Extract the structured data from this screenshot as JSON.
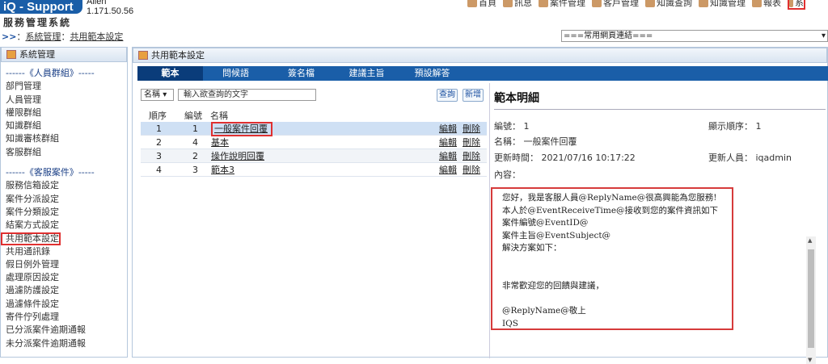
{
  "header": {
    "logo": "iQ - Support",
    "user": "Allen",
    "version": "1.171.50.56",
    "system_title": "服務管理系統",
    "nav": [
      {
        "label": "首頁",
        "icon": "home-icon"
      },
      {
        "label": "訊息",
        "icon": "message-icon"
      },
      {
        "label": "案件管理",
        "icon": "case-icon"
      },
      {
        "label": "客戶管理",
        "icon": "customer-icon"
      },
      {
        "label": "知識查詢",
        "icon": "knowledge-icon"
      },
      {
        "label": "知識管理",
        "icon": "knowledge-manage-icon"
      },
      {
        "label": "報表",
        "icon": "report-icon"
      },
      {
        "label": "系",
        "icon": "settings-icon"
      }
    ]
  },
  "breadcrumb": {
    "arrow": ">>",
    "sep": "：",
    "item1": "系統管理",
    "divider": "：",
    "item2": "共用範本設定"
  },
  "quick_links": {
    "value": "===常用網頁連結===",
    "arrow": "▾"
  },
  "sidebar": {
    "title": "系統管理",
    "group1": "------《人員群組》-----",
    "group1_items": [
      "部門管理",
      "人員管理",
      "權限群組",
      "知識群組",
      "知識審核群組",
      "客服群組"
    ],
    "group2": "------《客服案件》-----",
    "group2_items": [
      "服務信箱設定",
      "案件分派設定",
      "案件分類設定",
      "結案方式設定",
      "共用範本設定",
      "共用通訊錄",
      "假日例外管理",
      "處理原因設定",
      "過濾防護設定",
      "過濾條件設定",
      "寄件佇列處理",
      "已分派案件逾期通報",
      "未分派案件逾期通報"
    ]
  },
  "panel": {
    "title": "共用範本設定"
  },
  "tabs": [
    "範本",
    "問候語",
    "簽名檔",
    "建議主旨",
    "預設解答"
  ],
  "search": {
    "field": "名稱",
    "placeholder": "輸入欲查詢的文字",
    "query_label": "查詢",
    "add_label": "新增"
  },
  "table": {
    "headers": [
      "順序",
      "編號",
      "名稱"
    ],
    "rows": [
      {
        "order": "1",
        "id": "1",
        "name": "一般案件回覆",
        "edit": "編輯",
        "delete": "刪除"
      },
      {
        "order": "2",
        "id": "4",
        "name": "基本",
        "edit": "編輯",
        "delete": "刪除"
      },
      {
        "order": "3",
        "id": "2",
        "name": "操作說明回覆",
        "edit": "編輯",
        "delete": "刪除"
      },
      {
        "order": "4",
        "id": "3",
        "name": "範本3",
        "edit": "編輯",
        "delete": "刪除"
      }
    ]
  },
  "detail": {
    "title": "範本明細",
    "id_line": "編號： 1",
    "order_line": "顯示順序： 1",
    "name_line": "名稱： 一般案件回覆",
    "updated_line": "更新時間： 2021/07/16 10:17:22",
    "updater_line": "更新人員： iqadmin",
    "content_label": "內容：",
    "content": "您好，我是客服人員@ReplyName@很高興能為您服務!\n本人於@EventReceiveTime@接收到您的案件資訊如下\n案件編號@EventID@\n案件主旨@EventSubject@\n解決方案如下：\n\n\n非常歡迎您的回饋與建議，\n\n@ReplyName@敬上\nIQS\n@Today@"
  }
}
